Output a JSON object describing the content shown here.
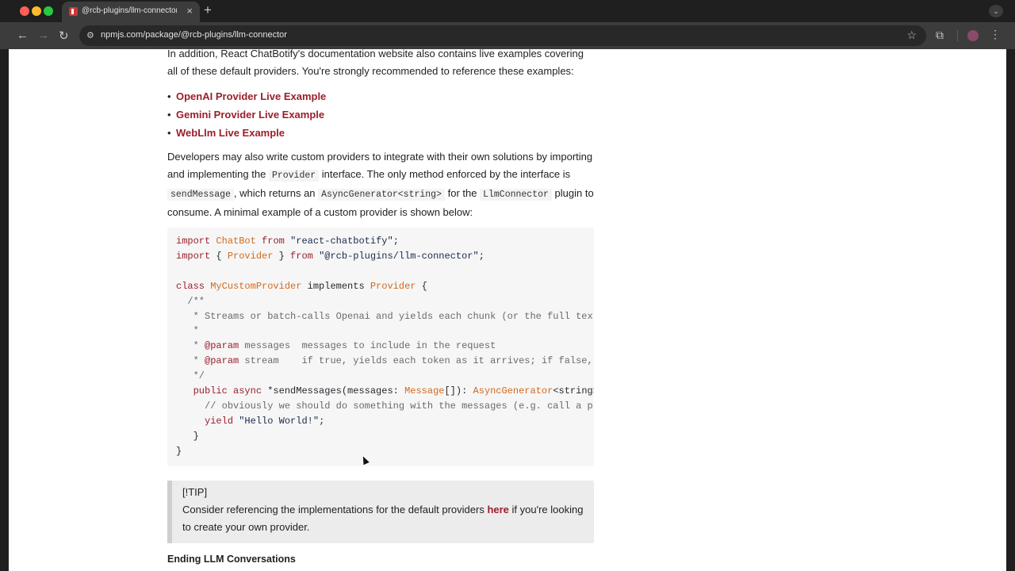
{
  "browser": {
    "tab_title": "@rcb-plugins/llm-connector",
    "tab_close": "×",
    "new_tab": "+",
    "url": "npmjs.com/package/@rcb-plugins/llm-connector"
  },
  "page": {
    "intro_text": "In addition, React ChatBotify's documentation website also contains live examples covering all of these default providers. You're strongly recommended to reference these examples:",
    "links": [
      "OpenAI Provider Live Example",
      "Gemini Provider Live Example",
      "WebLlm Live Example"
    ],
    "custom": {
      "t1": "Developers may also write custom providers to integrate with their own solutions by importing and implementing the",
      "c1": "Provider",
      "t2": "interface. The only method enforced by the interface is",
      "c2": "sendMessage",
      "t3": ", which returns an",
      "c3": "AsyncGenerator<string>",
      "t4": "for the",
      "c4": "LlmConnector",
      "t5": "plugin to consume. A minimal example of a custom provider is shown below:"
    },
    "code": {
      "l1_kw": "import",
      "l1_ty": "ChatBot",
      "l1_from": "from",
      "l1_str": "\"react-chatbotify\"",
      "l2_kw": "import",
      "l2_ty": "Provider",
      "l2_from": "from",
      "l2_str": "\"@rcb-plugins/llm-connector\"",
      "l4_kw": "class",
      "l4_ty": "MyCustomProvider",
      "l4_impl": "implements",
      "l4_ty2": "Provider",
      "l5": "/**",
      "l6": " * Streams or batch-calls Openai and yields each chunk (or the full text",
      "l7": " *",
      "l8_tag": "@param",
      "l8_rest": " messages  messages to include in the request",
      "l9_tag": "@param",
      "l9_rest": " stream    if true, yields each token as it arrives; if false, y",
      "l10": " */",
      "l11_kw": "public async",
      "l11_fn": " *sendMessages(messages: ",
      "l11_ty": "Message",
      "l11_mid": "[]): ",
      "l11_ty2": "AsyncGenerator",
      "l11_end": "<string>",
      "l12": "// obviously we should do something with the messages (e.g. call a pro",
      "l13_kw": "yield",
      "l13_str": "\"Hello World!\""
    },
    "tip_label": "[!TIP]",
    "tip_text_before": "Consider referencing the implementations for the default providers",
    "tip_link": "here",
    "tip_text_after": "if you're looking to create your own provider.",
    "next_heading": "Ending LLM Conversations"
  }
}
